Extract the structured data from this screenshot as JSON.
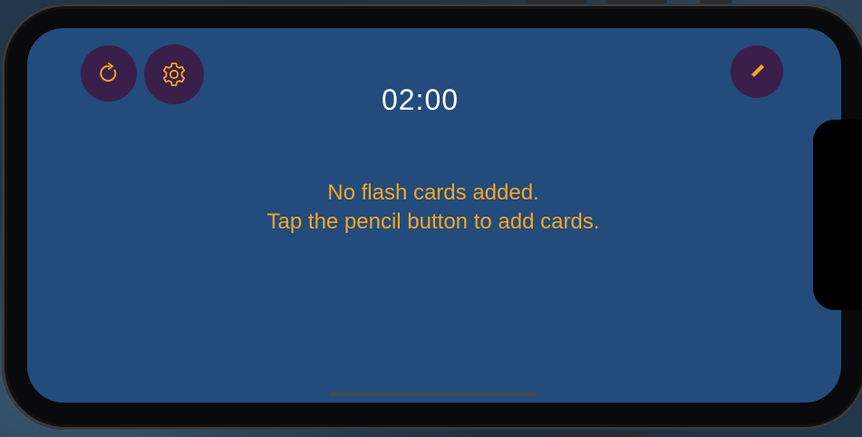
{
  "timer": {
    "value": "02:00"
  },
  "empty_state": {
    "line1": "No flash cards added.",
    "line2": "Tap the pencil button to add cards."
  },
  "icons": {
    "refresh": "refresh-icon",
    "settings": "gear-icon",
    "edit": "pencil-icon"
  },
  "colors": {
    "screen_background": "#234b7c",
    "button_background": "#3a1f4b",
    "accent": "#f5a623",
    "timer_text": "#ffffff"
  }
}
